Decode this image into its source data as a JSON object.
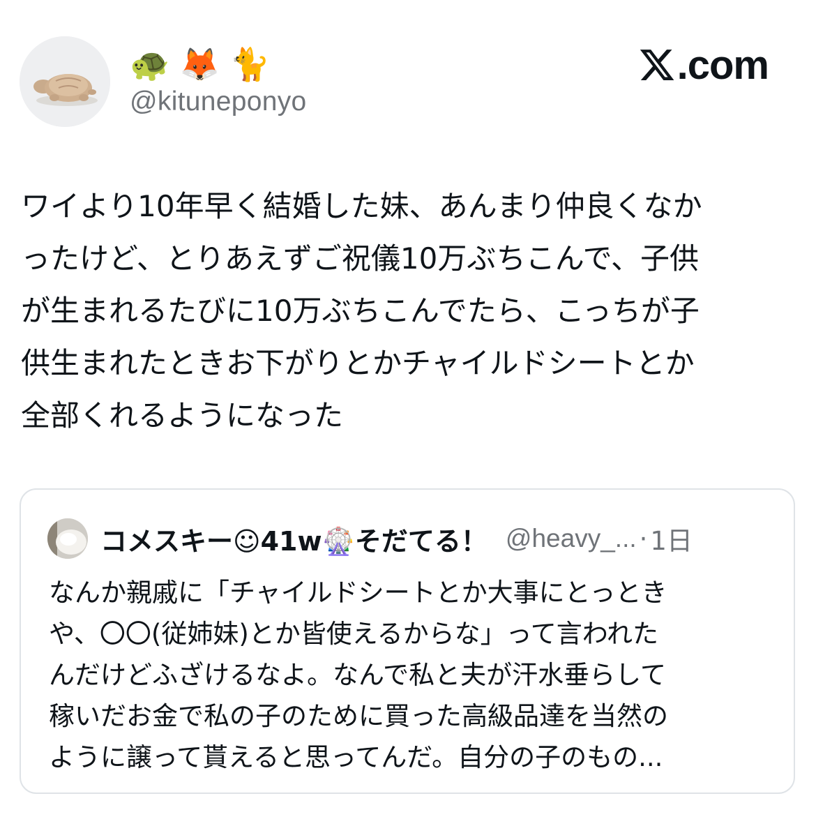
{
  "author": {
    "display_name": "🐢 🦊 🐈",
    "handle": "@kituneponyo"
  },
  "brand": {
    "logo_text": ".com",
    "logo_icon": "x-logo-icon"
  },
  "tweet": {
    "text": "ワイより10年早く結婚した妹、あんまり仲良くなか\nったけど、とりあえずご祝儀10万ぶちこんで、子供\nが生まれるたびに10万ぶちこんでたら、こっちが子\n供生まれたときお下がりとかチャイルドシートとか\n全部くれるようになった"
  },
  "quoted_tweet": {
    "display_name": "コメスキー☺41w🎡そだてる！",
    "handle": "@heavy_...",
    "separator": "·",
    "time": "1日",
    "text": "なんか親戚に「チャイルドシートとか大事にとっとき\nや、〇〇(従姉妹)とか皆使えるからな」って言われた\nんだけどふざけるなよ。なんで私と夫が汗水垂らして\n稼いだお金で私の子のために買った高級品達を当然の\nように譲って貰えると思ってんだ。自分の子のもの..."
  },
  "colors": {
    "text_primary": "#0f1419",
    "text_secondary": "#6f7378",
    "card_border": "#dfe3e7",
    "background": "#ffffff"
  }
}
